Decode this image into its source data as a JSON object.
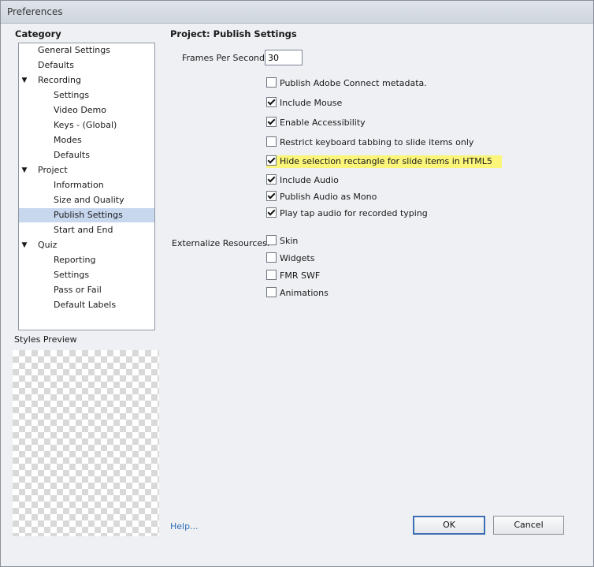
{
  "window": {
    "title": "Preferences"
  },
  "category": {
    "header": "Category",
    "items": [
      {
        "label": "General Settings",
        "level": 0,
        "expander": false,
        "selected": false
      },
      {
        "label": "Defaults",
        "level": 0,
        "expander": false,
        "selected": false
      },
      {
        "label": "Recording",
        "level": 0,
        "expander": true,
        "selected": false
      },
      {
        "label": "Settings",
        "level": 1,
        "expander": false,
        "selected": false
      },
      {
        "label": "Video Demo",
        "level": 1,
        "expander": false,
        "selected": false
      },
      {
        "label": "Keys - (Global)",
        "level": 1,
        "expander": false,
        "selected": false
      },
      {
        "label": "Modes",
        "level": 1,
        "expander": false,
        "selected": false
      },
      {
        "label": "Defaults",
        "level": 1,
        "expander": false,
        "selected": false
      },
      {
        "label": "Project",
        "level": 0,
        "expander": true,
        "selected": false
      },
      {
        "label": "Information",
        "level": 1,
        "expander": false,
        "selected": false
      },
      {
        "label": "Size and Quality",
        "level": 1,
        "expander": false,
        "selected": false
      },
      {
        "label": "Publish Settings",
        "level": 1,
        "expander": false,
        "selected": true
      },
      {
        "label": "Start and End",
        "level": 1,
        "expander": false,
        "selected": false
      },
      {
        "label": "Quiz",
        "level": 0,
        "expander": true,
        "selected": false
      },
      {
        "label": "Reporting",
        "level": 1,
        "expander": false,
        "selected": false
      },
      {
        "label": "Settings",
        "level": 1,
        "expander": false,
        "selected": false
      },
      {
        "label": "Pass or Fail",
        "level": 1,
        "expander": false,
        "selected": false
      },
      {
        "label": "Default Labels",
        "level": 1,
        "expander": false,
        "selected": false
      }
    ],
    "expander_glyph": "▼"
  },
  "styles_preview": {
    "label": "Styles Preview"
  },
  "publish": {
    "section_title": "Project: Publish Settings",
    "fps_label": "Frames Per Second:",
    "fps_value": "30",
    "options": [
      {
        "label": "Publish Adobe Connect metadata.",
        "checked": false,
        "highlight": false
      },
      {
        "label": "Include Mouse",
        "checked": true,
        "highlight": false
      },
      {
        "label": "Enable Accessibility",
        "checked": true,
        "highlight": false
      },
      {
        "label": "Restrict keyboard tabbing to slide items only",
        "checked": false,
        "highlight": false
      },
      {
        "label": "Hide selection rectangle for slide items in HTML5",
        "checked": true,
        "highlight": true
      },
      {
        "label": "Include Audio",
        "checked": true,
        "highlight": false
      },
      {
        "label": "Publish Audio as Mono",
        "checked": true,
        "highlight": false
      },
      {
        "label": "Play tap audio for recorded typing",
        "checked": true,
        "highlight": false
      }
    ],
    "externalize_label": "Externalize Resources:",
    "externalize": [
      {
        "label": "Skin",
        "checked": false
      },
      {
        "label": "Widgets",
        "checked": false
      },
      {
        "label": "FMR SWF",
        "checked": false
      },
      {
        "label": "Animations",
        "checked": false
      }
    ]
  },
  "footer": {
    "help": "Help...",
    "ok": "OK",
    "cancel": "Cancel"
  },
  "colors": {
    "highlight": "#fbf67a",
    "selection": "#c7d7ee",
    "link": "#2f6db5"
  }
}
